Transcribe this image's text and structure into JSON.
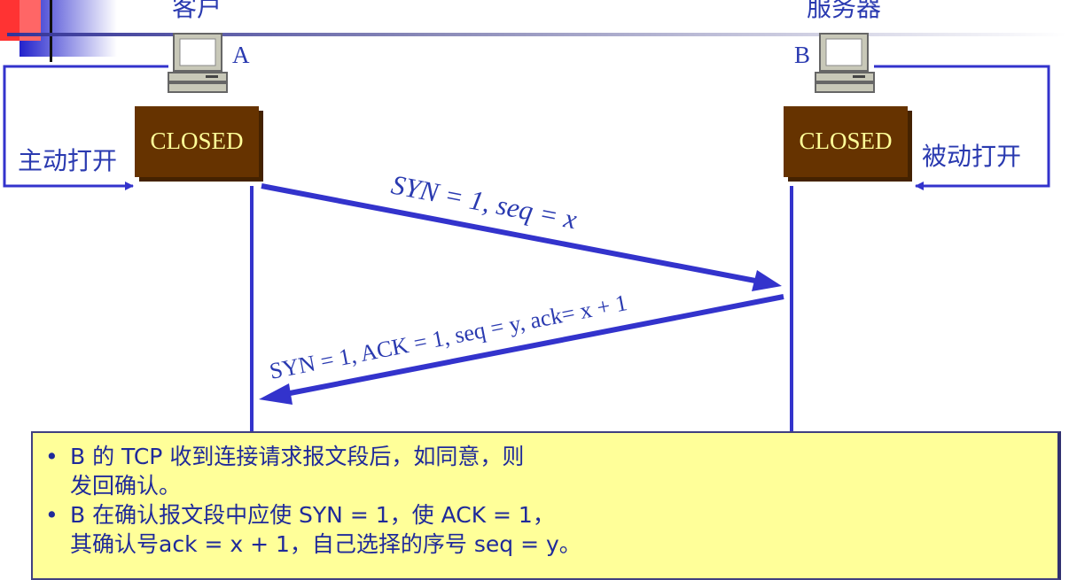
{
  "client": {
    "title": "客户",
    "host_label": "A",
    "state": "CLOSED",
    "action": "主动打开"
  },
  "server": {
    "title": "服务器",
    "host_label": "B",
    "state": "CLOSED",
    "action": "被动打开"
  },
  "messages": [
    {
      "text": "SYN = 1, seq = x",
      "direction": "A-to-B"
    },
    {
      "text": "SYN = 1, ACK = 1, seq = y, ack= x + 1",
      "direction": "B-to-A"
    }
  ],
  "notes": [
    {
      "bullet": "•",
      "lines": [
        "B 的 TCP 收到连接请求报文段后，如同意，则",
        "发回确认。"
      ]
    },
    {
      "bullet": "•",
      "lines": [
        "B 在确认报文段中应使 SYN = 1，使 ACK = 1，",
        "其确认号ack = x + 1，自己选择的序号 seq = y。"
      ]
    }
  ],
  "colors": {
    "arrow": "#3333cc",
    "state_box": "#663300",
    "state_text": "#ffff99",
    "label_text": "#2a3ab0",
    "note_bg": "#ffff99"
  }
}
